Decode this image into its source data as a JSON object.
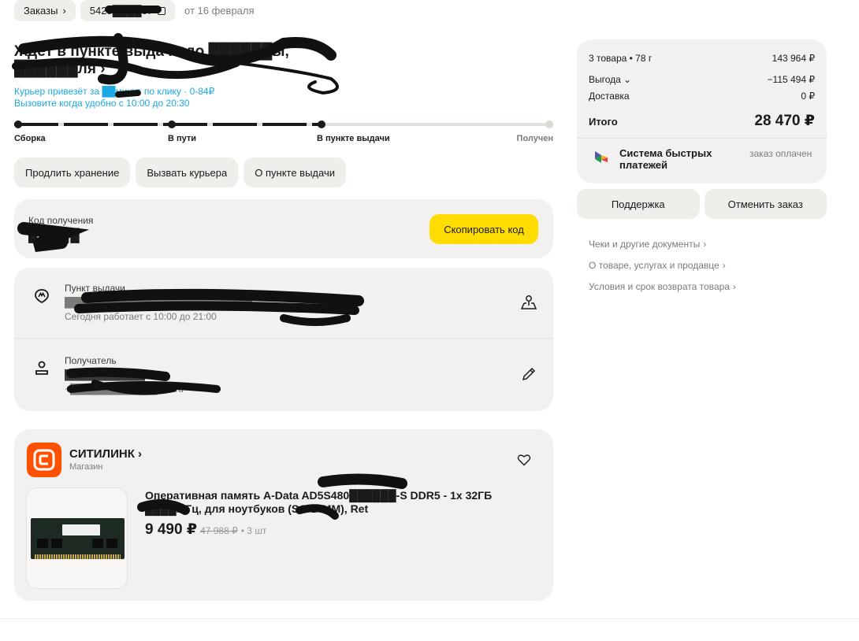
{
  "breadcrumbs": {
    "orders_label": "Заказы",
    "order_number": "5425████67",
    "order_date": "от 16 февраля"
  },
  "status": {
    "title": "Ждёт в пункте выдачи до ██████ы, ██████ля",
    "courier_line": "Курьер привезёт за ██минут по клику · 0-84₽",
    "courier_time": "Вызовите когда удобно с 10:00 до 20:30"
  },
  "progress": {
    "steps": [
      "Сборка",
      "В пути",
      "В пункте выдачи",
      "Получен"
    ],
    "current_step_index": 2
  },
  "actions": {
    "extend_storage": "Продлить хранение",
    "call_courier": "Вызвать курьера",
    "about_pickup": "О пункте выдачи"
  },
  "receipt_code": {
    "label": "Код получения",
    "value": "█████",
    "copy_button": "Скопировать код"
  },
  "pickup_point": {
    "label": "Пункт выдачи",
    "address": "████████████████████████████",
    "hours": "Сегодня работает с 10:00 до 21:00"
  },
  "recipient": {
    "label": "Получатель",
    "name": "████████████",
    "contact": "+█████████████dex.ru"
  },
  "shop": {
    "name": "СИТИЛИНК",
    "type": "Магазин"
  },
  "product": {
    "title": "Оперативная память A-Data AD5S480██████-S DDR5 - 1x 32ГБ ████МГц, для ноутбуков (SO-DIMM), Ret",
    "price": "9 490",
    "currency": "₽",
    "old_price": "47 988 ₽",
    "quantity": "• 3 шт"
  },
  "summary": {
    "items_label": "3 товара • 78 г",
    "items_value": "143 964 ₽",
    "benefit_label": "Выгода",
    "benefit_value": "−115 494 ₽",
    "delivery_label": "Доставка",
    "delivery_value": "0 ₽",
    "total_label": "Итого",
    "total_value": "28 470 ₽",
    "payment_name": "Система быстрых платежей",
    "payment_status": "заказ оплачен"
  },
  "side_buttons": {
    "support": "Поддержка",
    "cancel": "Отменить заказ"
  },
  "links": [
    "Чеки и другие документы",
    "О товаре, услугах и продавце",
    "Условия и срок возврата товара"
  ],
  "colors": {
    "accent_yellow": "#ffdd00",
    "courier_blue": "#1ba9e3",
    "shop_orange": "#ff5000",
    "card_bg": "#f2f1ef"
  }
}
